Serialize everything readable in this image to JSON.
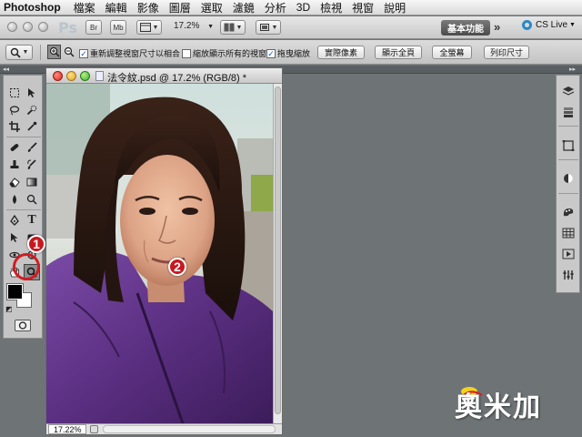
{
  "menubar": {
    "app_name": "Photoshop",
    "menus": [
      "檔案",
      "編輯",
      "影像",
      "圖層",
      "選取",
      "濾鏡",
      "分析",
      "3D",
      "檢視",
      "視窗",
      "說明"
    ]
  },
  "appbar": {
    "logo": "Ps",
    "bridge_label": "Br",
    "minibridge_label": "Mb",
    "zoom_level": "17.2%",
    "workspace_label": "基本功能",
    "more_label": "»",
    "cslive_label": "CS Live"
  },
  "options": {
    "resize_windows_label": "重新調整視窗尺寸以相合",
    "resize_windows_checked": true,
    "zoom_all_windows_label": "縮放顯示所有的視窗",
    "zoom_all_windows_checked": false,
    "scrubby_zoom_label": "拖曳縮放",
    "scrubby_zoom_checked": true,
    "actual_pixels_label": "實際像素",
    "fit_screen_label": "顯示全頁",
    "fill_screen_label": "全螢幕",
    "print_size_label": "列印尺寸"
  },
  "document": {
    "title": "法令紋.psd @ 17.2% (RGB/8) *",
    "zoom_field": "17.22%"
  },
  "callouts": [
    "1",
    "2"
  ],
  "watermark": {
    "text": "奧米加"
  },
  "colors": {
    "workspace_bg": "#6e7376",
    "callout_red": "#c8181f",
    "cslive_blue": "#2a88c8",
    "jacket_purple": "#5b2f82"
  },
  "icons": {
    "tools": [
      "marquee-icon",
      "move-icon",
      "lasso-icon",
      "quick-select-icon",
      "crop-icon",
      "eyedropper-icon",
      "healing-brush-icon",
      "brush-icon",
      "clone-stamp-icon",
      "history-brush-icon",
      "eraser-icon",
      "gradient-icon",
      "blur-icon",
      "dodge-icon",
      "pen-icon",
      "type-icon",
      "path-select-icon",
      "shape-icon",
      "3d-rotate-icon",
      "3d-camera-icon",
      "hand-icon",
      "zoom-icon"
    ],
    "dock": [
      "layers-icon",
      "channels-icon",
      "adjustments-icon",
      "masks-icon",
      "swatches-icon",
      "color-icon",
      "actions-icon",
      "styles-icon"
    ]
  }
}
